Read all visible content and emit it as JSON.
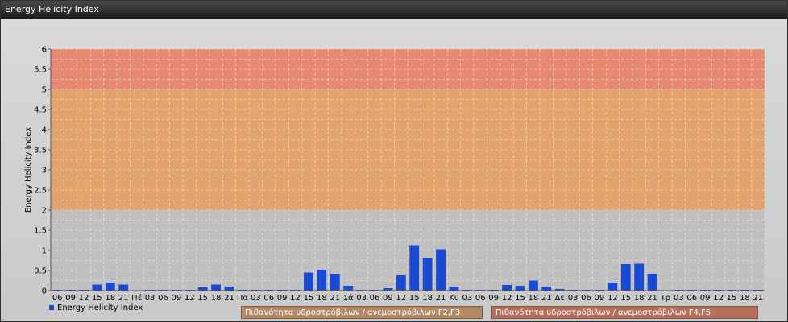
{
  "window": {
    "title": "Energy Helicity Index"
  },
  "legend": {
    "series_label": "Energy Helicity Index"
  },
  "bands": [
    {
      "label": "Πιθανότητα υδροστρόβιλων / ανεμοστρόβιλων F2,F3",
      "color": "#b48a66"
    },
    {
      "label": "Πιθανότητα υδροστρόβιλων / ανεμοστρόβιλων F4,F5",
      "color": "#b86f5e"
    }
  ],
  "chart_data": {
    "type": "bar",
    "ylabel": "Energy Helicity Index",
    "ylim": [
      0,
      6
    ],
    "yticks": [
      "0",
      "0.5",
      "1",
      "1.5",
      "2",
      "2.5",
      "3",
      "3.5",
      "4",
      "4.5",
      "5",
      "5.5",
      "6"
    ],
    "color": "#1a49d6",
    "zones": [
      {
        "from": 2,
        "to": 5,
        "color": "#e2a36c"
      },
      {
        "from": 5,
        "to": 6,
        "color": "#e78870"
      }
    ],
    "categories": [
      "06",
      "09",
      "12",
      "15",
      "18",
      "21",
      "Πέ",
      "03",
      "06",
      "09",
      "12",
      "15",
      "18",
      "21",
      "Πα",
      "03",
      "06",
      "09",
      "12",
      "15",
      "18",
      "21",
      "Σά",
      "03",
      "06",
      "09",
      "12",
      "15",
      "18",
      "21",
      "Κυ",
      "03",
      "06",
      "09",
      "12",
      "15",
      "18",
      "21",
      "Δε",
      "03",
      "06",
      "09",
      "12",
      "15",
      "18",
      "21",
      "Τρ",
      "03",
      "06",
      "09",
      "12",
      "15",
      "18",
      "21"
    ],
    "values": [
      0.02,
      0.02,
      0.02,
      0.15,
      0.2,
      0.15,
      0.01,
      0.02,
      0.02,
      0.02,
      0.02,
      0.08,
      0.15,
      0.1,
      0.02,
      0.02,
      0.02,
      0.02,
      0.02,
      0.45,
      0.52,
      0.42,
      0.12,
      0.02,
      0.02,
      0.06,
      0.38,
      1.13,
      0.82,
      1.03,
      0.1,
      0.02,
      0.02,
      0.02,
      0.14,
      0.12,
      0.25,
      0.1,
      0.04,
      0.02,
      0.02,
      0.02,
      0.2,
      0.66,
      0.67,
      0.42,
      0.01,
      0.02,
      0.02,
      0.02,
      0.02,
      0.02,
      0.02,
      0.02
    ],
    "legend_position": "bottom-left",
    "grid": true
  }
}
